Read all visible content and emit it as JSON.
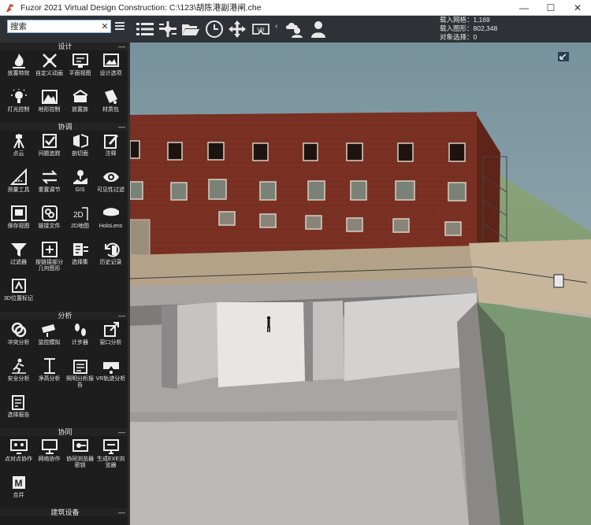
{
  "window": {
    "title": "Fuzor 2021 Virtual Design Construction: C:\\123\\胡陈港副港闸.che",
    "minimize_glyph": "—",
    "maximize_glyph": "☐",
    "close_glyph": "✕"
  },
  "search": {
    "label": "搜索",
    "clear_glyph": "✕"
  },
  "toolbar": {
    "icons": [
      "list-icon",
      "drone-icon",
      "folder-icon",
      "clock-icon",
      "move-icon",
      "vr-icon",
      "cloud-user-icon",
      "user-icon"
    ],
    "vr_text": "VR",
    "collapse_glyph": "‹"
  },
  "stats": {
    "line1": "载入网格：1,169",
    "line2": "载入图形：802,348",
    "line3": "对象选择：0"
  },
  "sidebar": {
    "sections": [
      {
        "title": "设计",
        "items": [
          {
            "label": "放置特效",
            "icon": "fire-icon"
          },
          {
            "label": "自定义动画",
            "icon": "custom-animation-icon"
          },
          {
            "label": "平面视图",
            "icon": "plan-view-icon"
          },
          {
            "label": "设计选项",
            "icon": "design-options-icon"
          },
          {
            "label": "灯光控制",
            "icon": "light-icon"
          },
          {
            "label": "地形控制",
            "icon": "terrain-icon"
          },
          {
            "label": "放置族",
            "icon": "place-family-icon"
          },
          {
            "label": "材质包",
            "icon": "material-icon"
          }
        ]
      },
      {
        "title": "协调",
        "items": [
          {
            "label": "点云",
            "icon": "point-cloud-icon"
          },
          {
            "label": "问题追踪",
            "icon": "issue-tracker-icon"
          },
          {
            "label": "剖切面",
            "icon": "section-icon"
          },
          {
            "label": "注释",
            "icon": "annotation-icon"
          },
          {
            "label": "测量工具",
            "icon": "measure-icon"
          },
          {
            "label": "重置调节",
            "icon": "reset-adjust-icon"
          },
          {
            "label": "GIS",
            "icon": "gis-icon"
          },
          {
            "label": "可见性过滤",
            "icon": "visibility-icon"
          },
          {
            "label": "保存视图",
            "icon": "save-view-icon"
          },
          {
            "label": "链接文件",
            "icon": "link-file-icon"
          },
          {
            "label": "2D地图",
            "icon": "map-2d-icon"
          },
          {
            "label": "HoloLens",
            "icon": "hololens-icon"
          },
          {
            "label": "过滤器",
            "icon": "filter-icon"
          },
          {
            "label": "按链接部分几何图形",
            "icon": "linked-geometry-icon"
          },
          {
            "label": "选择集",
            "icon": "selection-set-icon"
          },
          {
            "label": "历史记录",
            "icon": "history-icon"
          },
          {
            "label": "3D位置标记",
            "icon": "position-marker-icon"
          }
        ]
      },
      {
        "title": "分析",
        "items": [
          {
            "label": "冲突分析",
            "icon": "clash-icon"
          },
          {
            "label": "监控模拟",
            "icon": "camera-icon"
          },
          {
            "label": "计步器",
            "icon": "footsteps-icon"
          },
          {
            "label": "窗口分析",
            "icon": "window-analysis-icon"
          },
          {
            "label": "安全分析",
            "icon": "safety-icon"
          },
          {
            "label": "净高分析",
            "icon": "clearance-icon"
          },
          {
            "label": "照明分析报告",
            "icon": "lighting-report-icon"
          },
          {
            "label": "VR轨迹分析",
            "icon": "vr-track-icon"
          },
          {
            "label": "选择报告",
            "icon": "selection-report-icon"
          }
        ]
      },
      {
        "title": "协同",
        "items": [
          {
            "label": "点对点协作",
            "icon": "p2p-icon"
          },
          {
            "label": "网络协作",
            "icon": "network-icon"
          },
          {
            "label": "协同浏览器密钥",
            "icon": "browser-key-icon"
          },
          {
            "label": "生成EXE浏览器",
            "icon": "exe-icon"
          },
          {
            "label": "合并",
            "icon": "merge-icon"
          }
        ]
      },
      {
        "title": "建筑设备",
        "items": []
      }
    ],
    "collapse_glyph": "—"
  },
  "colors": {
    "toolbar_bg": "#2e3135",
    "panel_bg": "#1d1d1d",
    "header_bg": "#232323",
    "sky": "#7f9aa3",
    "brick": "#7a2f22"
  }
}
